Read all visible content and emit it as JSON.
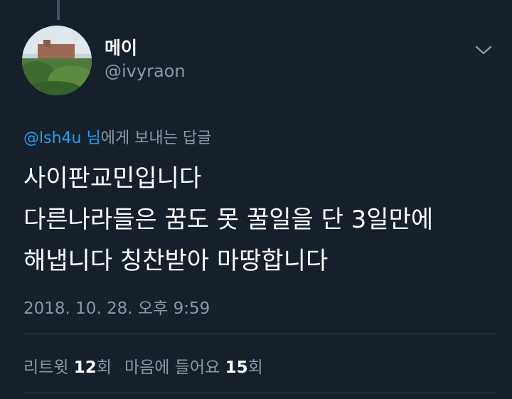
{
  "user": {
    "display_name": "메이",
    "handle": "@ivyraon"
  },
  "reply": {
    "mention": "@lsh4u 님",
    "suffix": "에게 보내는 답글"
  },
  "tweet": {
    "lines": [
      "사이판교민입니다",
      "다른나라들은 꿈도 못 꿀일을 단 3일만에",
      "해냅니다 칭찬받아 마땅합니다"
    ],
    "timestamp": "2018. 10. 28. 오후 9:59"
  },
  "stats": {
    "retweets_label": "리트윗",
    "retweets_count": "12",
    "retweets_unit": "회",
    "likes_label": "마음에 들어요",
    "likes_count": "15",
    "likes_unit": "회"
  },
  "icons": {
    "avatar": "avatar-photo",
    "more": "chevron-down-icon"
  },
  "colors": {
    "background": "#15202b",
    "primary_text": "#ffffff",
    "secondary_text": "#8899a6",
    "link": "#1da1f2",
    "divider": "#38444d"
  }
}
